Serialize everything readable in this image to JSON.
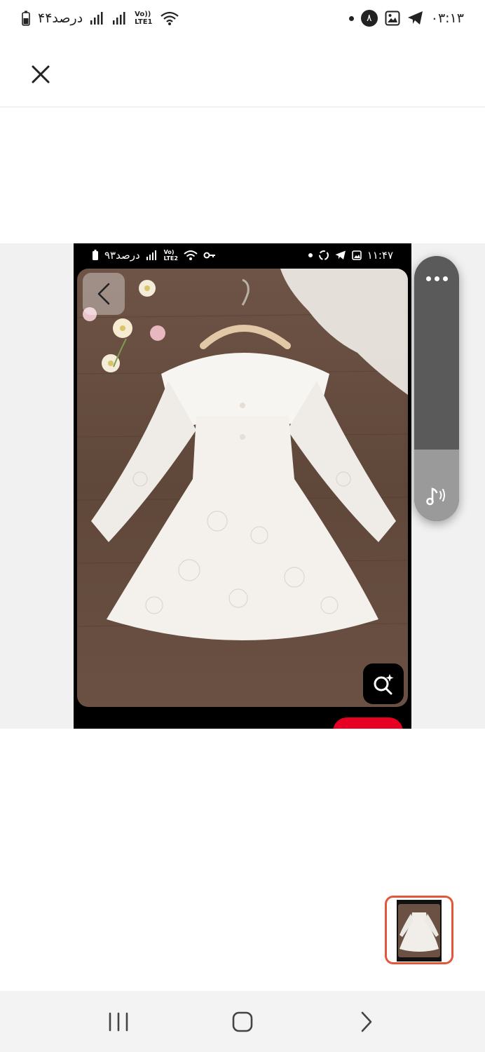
{
  "status_bar": {
    "time": "۰۳:۱۳",
    "notification_count": "۸",
    "battery": "۴۴درصد",
    "network_label": "Vo)) LTE1"
  },
  "embedded_status_bar": {
    "time": "۱۱:۴۷",
    "battery": "۹۳درصد",
    "network_label": "Vo) LTE2"
  },
  "icons": {
    "close": "close-icon",
    "back": "chevron-left-icon",
    "visual_search": "lens-search-icon",
    "more": "more-dots-icon",
    "audio": "music-note-icon",
    "nav_recents": "recents-icon",
    "nav_home": "home-icon",
    "nav_back": "back-icon"
  },
  "colors": {
    "accent_red": "#e60023",
    "thumb_border": "#e2573a"
  }
}
